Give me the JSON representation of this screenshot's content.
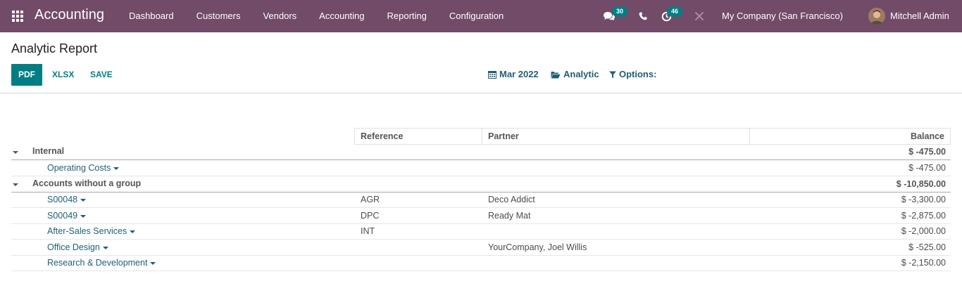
{
  "navbar": {
    "app_name": "Accounting",
    "menu": [
      "Dashboard",
      "Customers",
      "Vendors",
      "Accounting",
      "Reporting",
      "Configuration"
    ],
    "messages_count": "30",
    "activities_count": "46",
    "company": "My Company (San Francisco)",
    "user": "Mitchell Admin",
    "icons": [
      "apps-grid-icon",
      "chat-icon",
      "phone-icon",
      "clock-icon",
      "debug-icon"
    ]
  },
  "control_panel": {
    "title": "Analytic Report",
    "buttons": {
      "pdf": "PDF",
      "xlsx": "XLSX",
      "save": "SAVE"
    },
    "filters": {
      "date": "Mar 2022",
      "analytic": "Analytic",
      "options": "Options:"
    }
  },
  "colors": {
    "brand": "#714b67",
    "primary": "#017e84",
    "link": "#1f5f73"
  },
  "report": {
    "columns": {
      "reference": "Reference",
      "partner": "Partner",
      "balance": "Balance"
    },
    "rows": [
      {
        "type": "group",
        "name": "Internal",
        "balance": "$ -475.00"
      },
      {
        "type": "account",
        "name": "Operating Costs",
        "reference": "",
        "partner": "",
        "balance": "$ -475.00"
      },
      {
        "type": "group",
        "name": "Accounts without a group",
        "balance": "$ -10,850.00"
      },
      {
        "type": "account",
        "name": "S00048",
        "reference": "AGR",
        "partner": "Deco Addict",
        "balance": "$ -3,300.00"
      },
      {
        "type": "account",
        "name": "S00049",
        "reference": "DPC",
        "partner": "Ready Mat",
        "balance": "$ -2,875.00"
      },
      {
        "type": "account",
        "name": "After-Sales Services",
        "reference": "INT",
        "partner": "",
        "balance": "$ -2,000.00"
      },
      {
        "type": "account",
        "name": "Office Design",
        "reference": "",
        "partner": "YourCompany, Joel Willis",
        "balance": "$ -525.00"
      },
      {
        "type": "account",
        "name": "Research & Development",
        "reference": "",
        "partner": "",
        "balance": "$ -2,150.00"
      }
    ]
  }
}
